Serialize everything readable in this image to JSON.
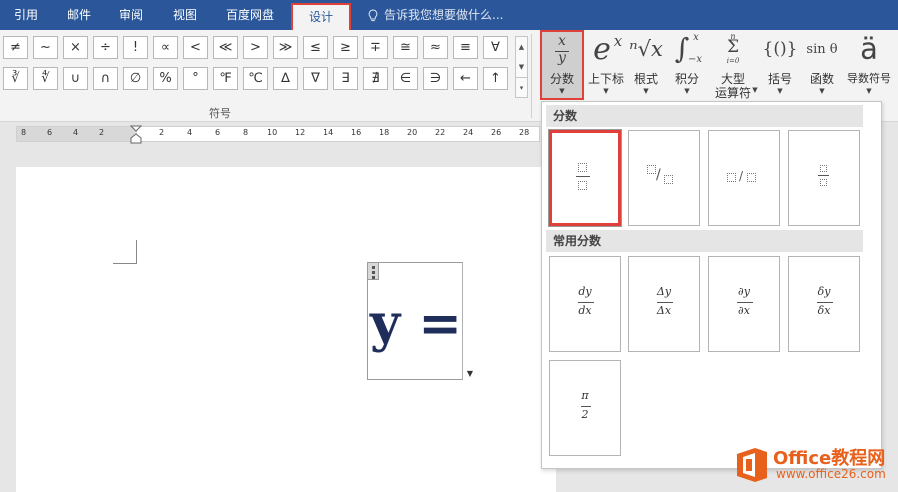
{
  "tabs": [
    "引用",
    "邮件",
    "审阅",
    "视图",
    "百度网盘",
    "设计"
  ],
  "active_tab": "设计",
  "tell_me": "告诉我您想要做什么...",
  "symbols_row1": [
    "≠",
    "~",
    "×",
    "÷",
    "!",
    "∝",
    "<",
    "≪",
    ">",
    "≫",
    "≤",
    "≥",
    "∓",
    "≅",
    "≈",
    "≡",
    "∀"
  ],
  "symbols_row2": [
    "∛",
    "∜",
    "∪",
    "∩",
    "∅",
    "%",
    "°",
    "℉",
    "℃",
    "∆",
    "∇",
    "∃",
    "∄",
    "∈",
    "∋",
    "←",
    "↑"
  ],
  "symbols_group_label": "符号",
  "buttons": {
    "fraction": {
      "label": "分数",
      "num": "x",
      "den": "y"
    },
    "script": {
      "label": "上下标",
      "glyph_base": "e",
      "glyph_sup": "x"
    },
    "radical": {
      "label": "根式",
      "glyph": "ⁿ√x"
    },
    "integral": {
      "label": "积分",
      "glyph": "∫",
      "upper": "x",
      "lower": "−x"
    },
    "large_operator": {
      "label1": "大型",
      "label2": "运算符",
      "upper": "n",
      "glyph": "Σ",
      "lower": "i=0"
    },
    "bracket": {
      "label": "括号",
      "glyph": "{()}"
    },
    "function": {
      "label": "函数",
      "glyph": "sin θ"
    },
    "accent": {
      "label": "导数符号",
      "glyph": "ä"
    }
  },
  "ruler_ticks": [
    "8",
    "6",
    "4",
    "2",
    "2",
    "4",
    "6",
    "8",
    "10",
    "12",
    "14",
    "16",
    "18",
    "20",
    "22",
    "24",
    "26",
    "28"
  ],
  "equation_text": "y =",
  "gallery": {
    "section1_title": "分数",
    "section2_title": "常用分数",
    "common_fractions": [
      {
        "num": "dy",
        "den": "dx"
      },
      {
        "num": "Δy",
        "den": "Δx"
      },
      {
        "num": "∂y",
        "den": "∂x"
      },
      {
        "num": "δy",
        "den": "δx"
      },
      {
        "num": "π",
        "den": "2"
      }
    ]
  },
  "watermark": {
    "title": "Office教程网",
    "url": "www.office26.com"
  },
  "colors": {
    "ribbon_blue": "#2b579a",
    "highlight_red": "#e0403a",
    "logo_orange": "#e8611c"
  }
}
